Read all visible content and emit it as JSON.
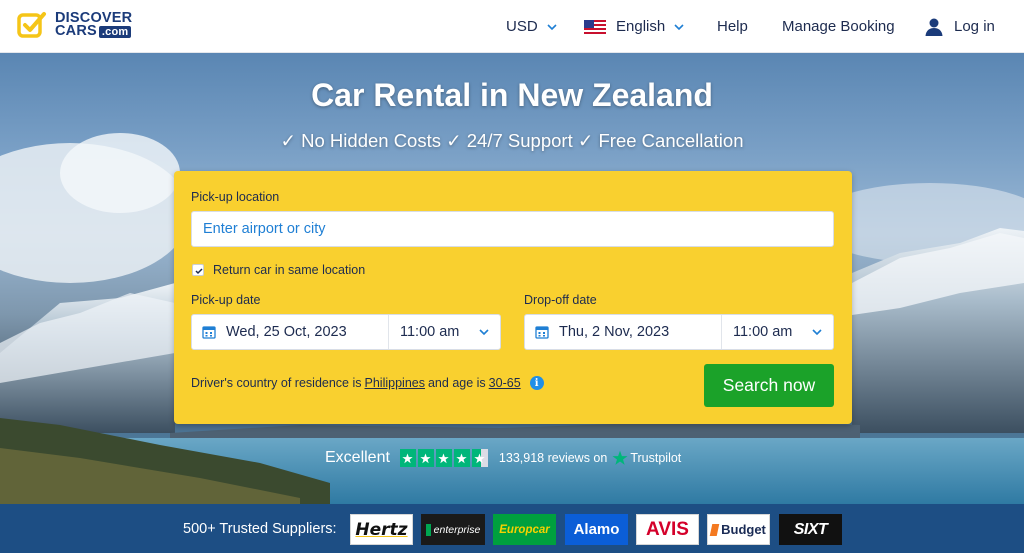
{
  "header": {
    "logo": {
      "line1": "DISCOVER",
      "line2": "CARS",
      "domain": ".com"
    },
    "currency": "USD",
    "language": "English",
    "help": "Help",
    "manage_booking": "Manage Booking",
    "login": "Log in"
  },
  "hero": {
    "title": "Car Rental in New Zealand",
    "subtitle": "✓ No Hidden Costs ✓ 24/7 Support ✓ Free Cancellation"
  },
  "search": {
    "pickup_location_label": "Pick-up location",
    "pickup_location_placeholder": "Enter airport or city",
    "return_same_label": "Return car in same location",
    "return_same_checked": true,
    "pickup_date_label": "Pick-up date",
    "pickup_date": "Wed, 25 Oct, 2023",
    "pickup_time": "11:00 am",
    "dropoff_date_label": "Drop-off date",
    "dropoff_date": "Thu, 2 Nov, 2023",
    "dropoff_time": "11:00 am",
    "residence_prefix": "Driver's country of residence is",
    "residence_country": "Philippines",
    "age_prefix": "and age is",
    "age_range": "30-65",
    "search_button": "Search now"
  },
  "trustpilot": {
    "rating_word": "Excellent",
    "stars": 4.5,
    "reviews_text": "133,918 reviews on",
    "brand": "Trustpilot"
  },
  "suppliers": {
    "label": "500+ Trusted Suppliers:",
    "brands": [
      "Hertz",
      "enterprise",
      "Europcar",
      "Alamo",
      "AVIS",
      "Budget",
      "SIXT"
    ]
  },
  "colors": {
    "accent_yellow": "#f9d02f",
    "search_green": "#1ba229",
    "brand_navy": "#1b3b7a",
    "supplier_strip": "#1d4e84",
    "trustpilot_green": "#00b67a"
  }
}
